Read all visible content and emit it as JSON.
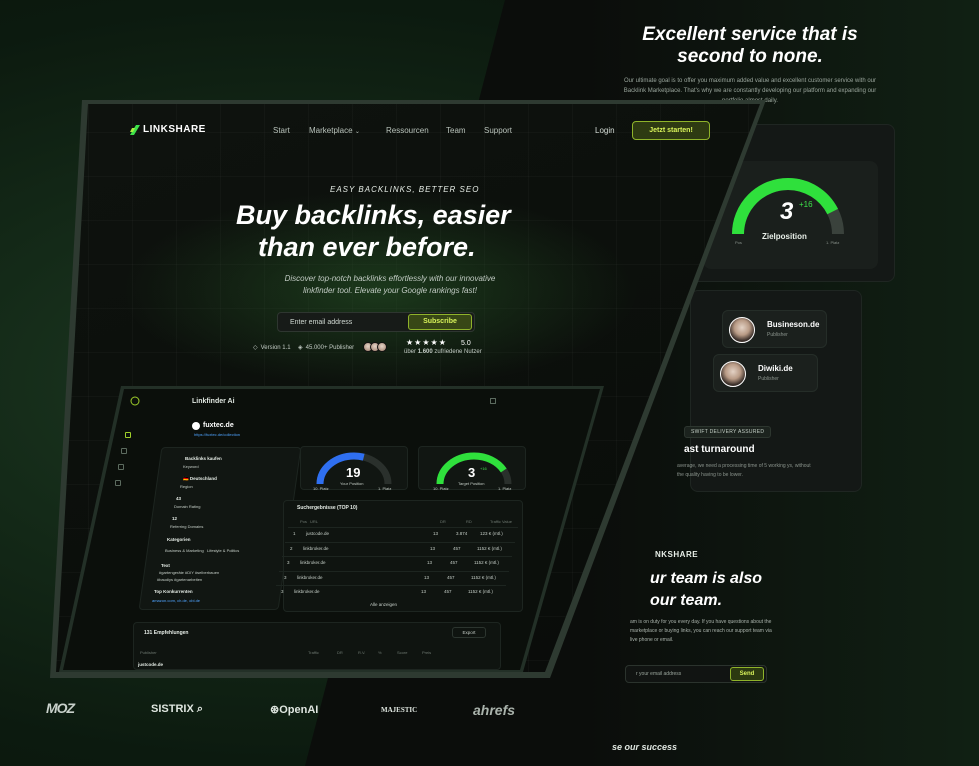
{
  "right_panel": {
    "service_title_1": "Excellent service that is",
    "service_title_2": "second to none.",
    "service_sub": "Our ultimate goal is to offer you maximum added value and excellent customer service with our Backlink Marketplace. That's why we are constantly developing our platform and expanding our portfolio almost daily.",
    "gauge": {
      "value": "3",
      "delta": "+16",
      "label": "Zielposition",
      "low": "Pos",
      "high": "1. Platz",
      "fill": 0.85
    },
    "publishers": [
      {
        "name": "Busineson.de",
        "role": "Publisher"
      },
      {
        "name": "Diwiki.de",
        "role": "Publisher"
      }
    ],
    "swift_badge": "SWIFT DELIVERY ASSURED",
    "fast_title": "ast turnaround",
    "fast_sub": "average, we need a processing time of 5 working ys, without the quality having to be lower.",
    "team_kicker": "NKSHARE",
    "team_title_1": "ur team is also",
    "team_title_2": "our team.",
    "team_body": "am is on duty for you every day. If you have questions about the marketplace or buying links, you can reach our support team via live phone or email.",
    "team_input_placeholder": "r your email address",
    "team_send": "Send",
    "success": "se our success"
  },
  "header": {
    "logo": "LINKSHARE",
    "nav": [
      "Start",
      "Marketplace",
      "Ressourcen",
      "Team",
      "Support"
    ],
    "login": "Login",
    "cta": "Jetzt starten!"
  },
  "hero": {
    "kicker": "EASY BACKLINKS, BETTER SEO",
    "title_1": "Buy backlinks, easier",
    "title_2": "than ever before.",
    "sub_1": "Discover top-notch backlinks effortlessly with our innovative",
    "sub_2": "linkfinder tool. Elevate your Google rankings fast!",
    "email_placeholder": "Enter email address",
    "subscribe": "Subscribe",
    "version": "Version 1.1",
    "publishers": "45.000+ Publisher",
    "stars": "★★★★★",
    "rating": "5.0",
    "rating_sub_pre": "über ",
    "rating_sub_num": "1.600",
    "rating_sub_post": " zufriedene Nutzer"
  },
  "app": {
    "title": "Linkfinder Ai",
    "site": "fuxtec.de",
    "site_url": "https://fuxtec.de/collection",
    "left": {
      "buy": "Backlinks kaufen",
      "source": "Keyword",
      "country": "Deutschland",
      "region": "Region",
      "num1": "43",
      "num1_lbl": "Domain Rating",
      "num2": "12",
      "num2_lbl": "Referring Domains",
      "cat": "Kategorien",
      "cat1": "Business & Marketing",
      "cat2": "Lifestyle & Politics",
      "text": "Text",
      "tags": "#gartengeräte  #DIY  #selberbauen",
      "tags2": "#baudiys  #gartenarbeiten",
      "top": "Top Konkurrenten",
      "comp": "amazon.com, ch.de, obi.de"
    },
    "gauges": [
      {
        "value": "19",
        "label": "Your Position",
        "low": "10. Platz",
        "high": "1. Platz",
        "fill": 0.6,
        "color": "#2f6ff0"
      },
      {
        "value": "3",
        "delta": "+16",
        "label": "Target Position",
        "low": "10. Platz",
        "high": "1. Platz",
        "fill": 0.85,
        "color": "#2fe03c"
      }
    ],
    "results_title": "Suchergebnisse (TOP 10)",
    "results_head": [
      "Pos",
      "URL",
      "DR",
      "RD",
      "Traffic Value"
    ],
    "results": [
      {
        "pos": "1",
        "url": "justcode.de",
        "dr": "13",
        "rd": "3.874",
        "val": "123 € (mtl.)"
      },
      {
        "pos": "2",
        "url": "linkbroker.de",
        "dr": "13",
        "rd": "457",
        "val": "1152 € (mtl.)"
      },
      {
        "pos": "3",
        "url": "linkbroker.de",
        "dr": "13",
        "rd": "457",
        "val": "1152 € (mtl.)"
      },
      {
        "pos": "3",
        "url": "linkbroker.de",
        "dr": "13",
        "rd": "457",
        "val": "1152 € (mtl.)"
      },
      {
        "pos": "3",
        "url": "linkbroker.de",
        "dr": "13",
        "rd": "457",
        "val": "1152 € (mtl.)"
      }
    ],
    "show_all": "Alle anzeigen",
    "recommendations": "131 Empfehlungen",
    "export": "Export",
    "rec_head": [
      "Publisher",
      "Traffic",
      "DR",
      "R.V.",
      "%",
      "Score",
      "Preis"
    ],
    "rec_first": "justcode.de"
  },
  "brands": [
    "MOZ",
    "SISTRIX",
    "OpenAI",
    "MAJESTIC",
    "ahrefs"
  ],
  "colors": {
    "accent": "#d9f45a",
    "accent_border": "#8fb32a",
    "green_gauge": "#2fe03c",
    "blue_gauge": "#2f6ff0"
  }
}
